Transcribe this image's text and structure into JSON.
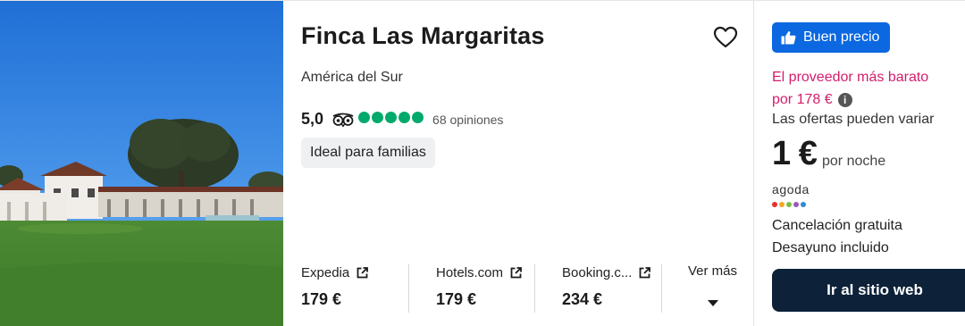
{
  "hotel": {
    "name": "Finca Las Margaritas",
    "location": "América del Sur",
    "rating": "5,0",
    "reviews": "68 opiniones",
    "bubbles": 5,
    "tag": "Ideal para familias",
    "photo_alt": "hotel-photo"
  },
  "providers": [
    {
      "name": "Expedia",
      "price": "179 €"
    },
    {
      "name": "Hotels.com",
      "price": "179 €"
    },
    {
      "name": "Booking.c...",
      "price": "234 €"
    }
  ],
  "more_label": "Ver más",
  "deal": {
    "badge": "Buen precio",
    "cheapest_line1": "El proveedor más barato",
    "cheapest_line2": "por 178 €",
    "info_symbol": "i",
    "vary": "Las ofertas pueden variar",
    "price": "1 €",
    "per_night": "por noche",
    "provider_logo": "agoda",
    "amenity1": "Cancelación gratuita",
    "amenity2": "Desayuno incluido",
    "cta": "Ir al sitio web"
  },
  "colors": {
    "accent_blue": "#0b68e0",
    "cta_navy": "#0d2239",
    "cheap_pink": "#d31d6c",
    "bubble_green": "#00aa6c"
  },
  "icons": [
    "heart-icon",
    "tripadvisor-owl-icon",
    "external-link-icon",
    "thumbs-up-icon",
    "info-icon",
    "chevron-down-icon"
  ]
}
